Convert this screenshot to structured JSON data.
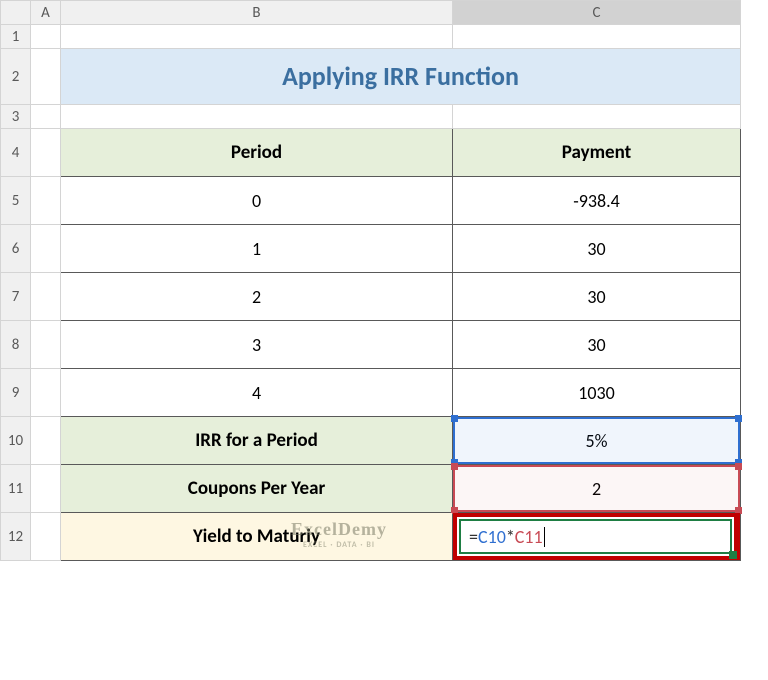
{
  "columns": {
    "A": "A",
    "B": "B",
    "C": "C"
  },
  "rows": [
    "1",
    "2",
    "3",
    "4",
    "5",
    "6",
    "7",
    "8",
    "9",
    "10",
    "11",
    "12"
  ],
  "title": "Applying IRR Function",
  "headers": {
    "period": "Period",
    "payment": "Payment"
  },
  "data": {
    "r5": {
      "period": "0",
      "payment": "-938.4"
    },
    "r6": {
      "period": "1",
      "payment": "30"
    },
    "r7": {
      "period": "2",
      "payment": "30"
    },
    "r8": {
      "period": "3",
      "payment": "30"
    },
    "r9": {
      "period": "4",
      "payment": "1030"
    }
  },
  "labels": {
    "irr": "IRR for a Period",
    "coupons": "Coupons Per Year",
    "ytm": "Yield to Maturiy"
  },
  "values": {
    "irr": "5%",
    "coupons": "2"
  },
  "formula": {
    "eq": "=",
    "ref1": "C10",
    "op": "*",
    "ref2": "C11"
  },
  "watermark": {
    "line1": "ExcelDemy",
    "line2": "EXCEL · DATA · BI"
  },
  "chart_data": {
    "type": "table",
    "title": "Applying IRR Function",
    "columns": [
      "Period",
      "Payment"
    ],
    "rows": [
      [
        "0",
        -938.4
      ],
      [
        "1",
        30
      ],
      [
        "2",
        30
      ],
      [
        "3",
        30
      ],
      [
        "4",
        1030
      ]
    ],
    "summary": {
      "IRR for a Period": "5%",
      "Coupons Per Year": 2,
      "Yield to Maturiy": "=C10*C11"
    }
  }
}
